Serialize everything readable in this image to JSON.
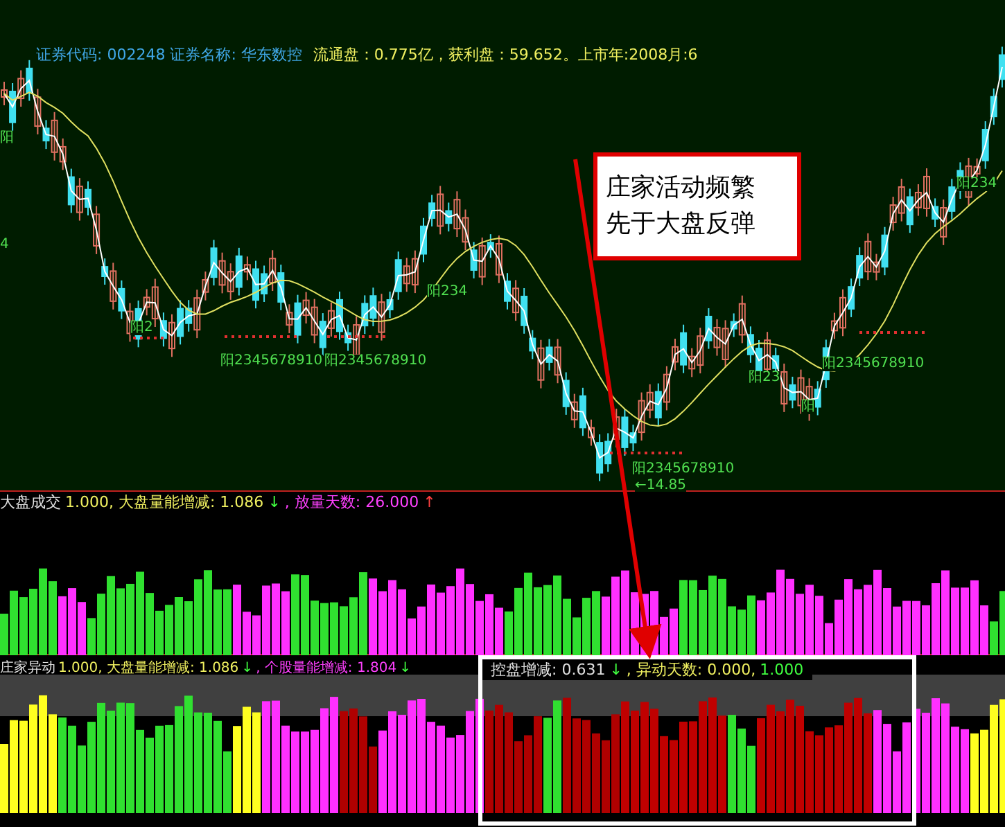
{
  "price_panel": {
    "info": [
      {
        "text": "证券代码: 002248 证券名称: 华东数控",
        "color": "#40a8e8"
      },
      {
        "text": "流通盘：0.775亿，获利盘：59.652。上市年:2008月:6",
        "color": "#f0f060"
      }
    ],
    "markers": [
      {
        "text": "阳"
      },
      {
        "text": "4"
      },
      {
        "text": "阳2"
      },
      {
        "text": "阳2345678910"
      },
      {
        "text": "阳2345678910"
      },
      {
        "text": "阳234"
      },
      {
        "text": "阳2345678910"
      },
      {
        "text": "←14.85"
      },
      {
        "text": "阳23"
      },
      {
        "text": "阳2345678910"
      },
      {
        "text": "阳"
      },
      {
        "text": "阳234"
      }
    ],
    "callout": [
      "庄家活动频繁",
      "先于大盘反弹"
    ]
  },
  "market_volume_panel": {
    "legend": [
      {
        "text": "大盘成交",
        "color": "#e0e0e0"
      },
      {
        "text": "1.000, 大盘量能增减: 1.086",
        "color": "#f0f060"
      },
      {
        "text": "↓",
        "color": "#40ff40"
      },
      {
        "text": ", 放量天数: 26.000",
        "color": "#ff40ff"
      },
      {
        "text": "↑",
        "color": "#ff4040"
      }
    ]
  },
  "dealer_panel": {
    "legend": [
      {
        "text": "庄家异动",
        "color": "#e0e0e0"
      },
      {
        "text": "1.000, 大盘量能增减: 1.086",
        "color": "#f0f060"
      },
      {
        "text": "↓",
        "color": "#40ff40"
      },
      {
        "text": ", 个股量能增减: 1.804",
        "color": "#ff40ff"
      },
      {
        "text": "↓",
        "color": "#40ff40"
      }
    ],
    "highlight_legend": [
      {
        "text": "控盘增减: 0.631",
        "color": "#e0e0e0"
      },
      {
        "text": "↓",
        "color": "#40ff40"
      },
      {
        "text": ", 异动天数: 0.000,",
        "color": "#f0f060"
      },
      {
        "text": "1.000",
        "color": "#40ff40"
      }
    ]
  }
}
